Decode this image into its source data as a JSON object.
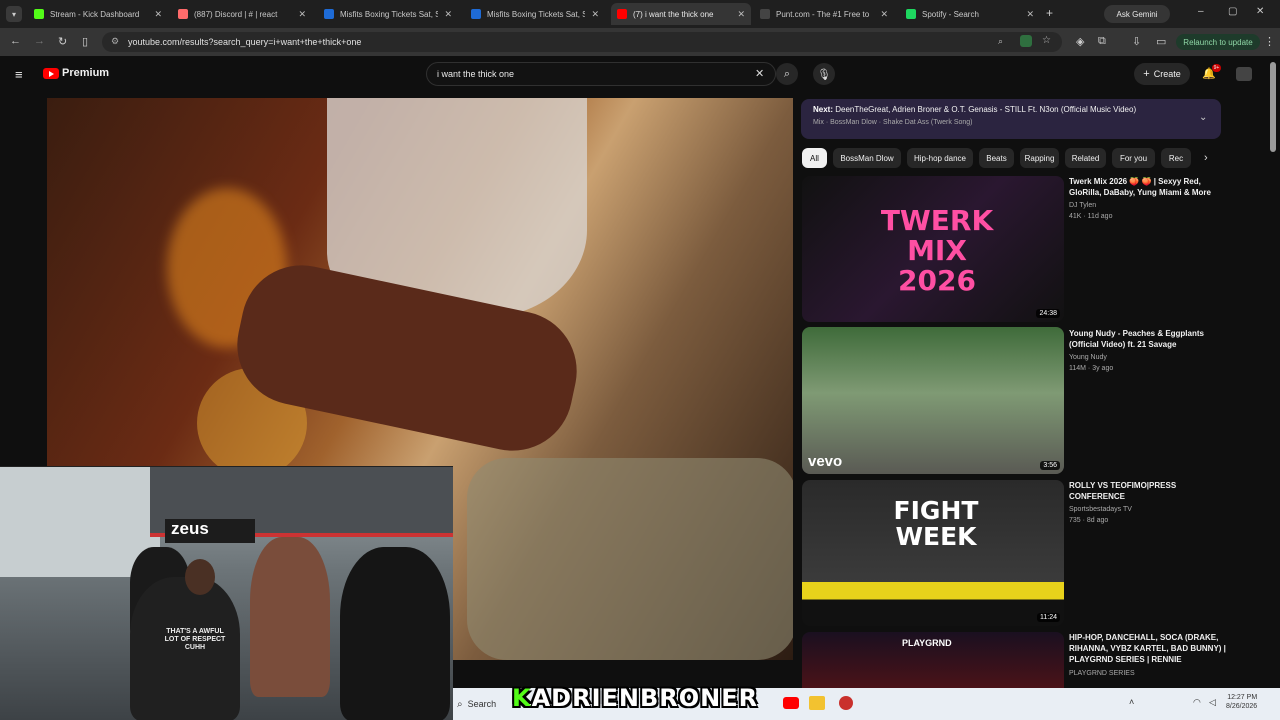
{
  "browser": {
    "tabs": [
      {
        "title": "Stream - Kick Dashboard",
        "color": "#53fc18",
        "active": false
      },
      {
        "title": "(887) Discord | # | react",
        "color": "#ff6b6b",
        "active": false
      },
      {
        "title": "Misfits Boxing Tickets Sat, S",
        "color": "#1e6bd6",
        "active": false
      },
      {
        "title": "Misfits Boxing Tickets Sat, S",
        "color": "#1e6bd6",
        "active": false
      },
      {
        "title": "(7) i want the thick one",
        "color": "#ff0000",
        "active": true
      },
      {
        "title": "Punt.com - The #1 Free to",
        "color": "#444444",
        "active": false
      },
      {
        "title": "Spotify - Search",
        "color": "#1ed760",
        "active": false
      }
    ],
    "new_tab": "+",
    "ask_gemini": "Ask Gemini",
    "url": "youtube.com/results?search_query=i+want+the+thick+one",
    "relaunch": "Relaunch to update"
  },
  "youtube": {
    "logo_text": "Premium",
    "search_value": "i want the thick one",
    "create_label": "Create",
    "notif_count": "9+",
    "next_up": {
      "label": "Next:",
      "title": "DeenTheGreat, Adrien Broner & O.T. Genasis - STILL Ft. N3on (Official Music Video)",
      "mix": "Mix · BossMan Dlow · Shake Dat Ass (Twerk Song)"
    },
    "chips": [
      "All",
      "BossMan Dlow",
      "Hip-hop dance",
      "Beats",
      "Rapping",
      "Related",
      "For you",
      "Rec"
    ],
    "videos": [
      {
        "title": "Twerk Mix 2026 🍑 🍑 | Sexyy Red, GloRilla, DaBaby, Yung Miami & More",
        "channel": "DJ Tylen",
        "meta": "41K · 11d ago",
        "duration": "24:38",
        "thumb_text": "TWERK MIX 2026"
      },
      {
        "title": "Young Nudy - Peaches & Eggplants (Official Video) ft. 21 Savage",
        "channel": "Young Nudy",
        "meta": "114M · 3y ago",
        "duration": "3:56",
        "thumb_text": "vevo"
      },
      {
        "title": "ROLLY VS TEOFIMO|PRESS CONFERENCE",
        "channel": "Sportsbestadays TV",
        "meta": "735 · 8d ago",
        "duration": "11:24",
        "thumb_text": "FIGHT WEEK"
      },
      {
        "title": "HIP-HOP, DANCEHALL, SOCA (DRAKE, RIHANNA, VYBZ KARTEL, BAD BUNNY) | PLAYGRND SERIES | RENNIE",
        "channel": "PLAYGRND SERIES",
        "meta": "",
        "duration": "",
        "thumb_text": "PLAYGRND"
      }
    ]
  },
  "overlay": {
    "webcam_banner": "zeus",
    "shirt_text": "THAT'S A AWFUL LOT OF RESPECT CUHH",
    "stream_k": "K",
    "stream_name": "ADRIENBRONER"
  },
  "taskbar": {
    "search_label": "Search",
    "time": "12:27 PM",
    "date": "8/26/2026"
  }
}
